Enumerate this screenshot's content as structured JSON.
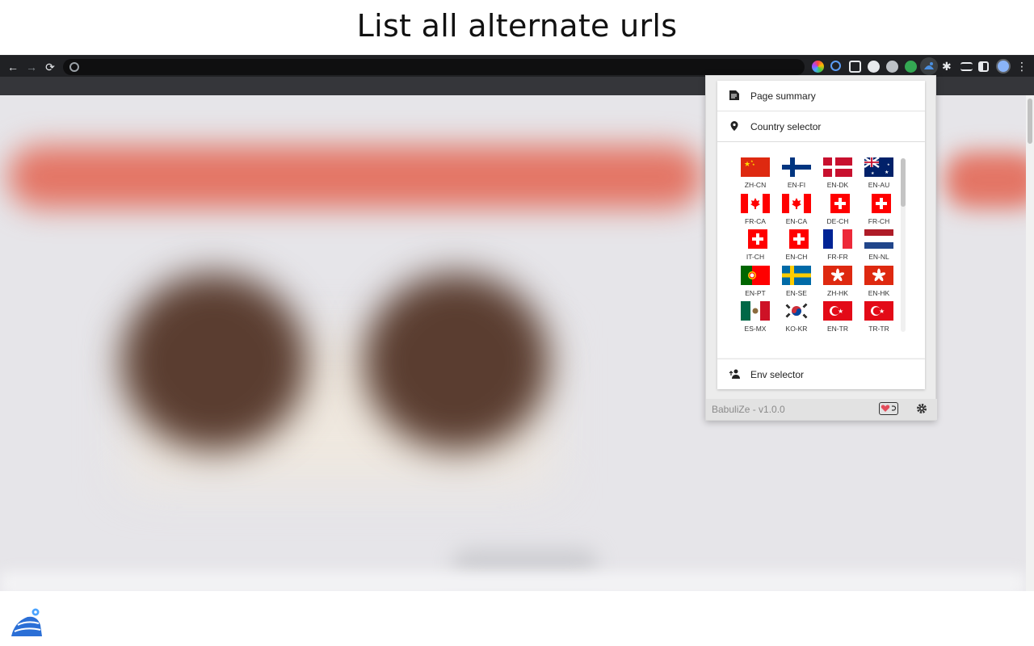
{
  "headline": "List all alternate urls",
  "browser": {
    "nav": {
      "back_icon": "←",
      "forward_icon": "→",
      "reload_icon": "⟳"
    }
  },
  "popup": {
    "menu": {
      "page_summary": "Page summary",
      "country_selector": "Country selector",
      "env_selector": "Env selector"
    },
    "countries": [
      {
        "code": "ZH-CN",
        "flag": "cn"
      },
      {
        "code": "EN-FI",
        "flag": "fi"
      },
      {
        "code": "EN-DK",
        "flag": "dk"
      },
      {
        "code": "EN-AU",
        "flag": "au"
      },
      {
        "code": "FR-CA",
        "flag": "ca"
      },
      {
        "code": "EN-CA",
        "flag": "ca"
      },
      {
        "code": "DE-CH",
        "flag": "ch"
      },
      {
        "code": "FR-CH",
        "flag": "ch"
      },
      {
        "code": "IT-CH",
        "flag": "ch"
      },
      {
        "code": "EN-CH",
        "flag": "ch"
      },
      {
        "code": "FR-FR",
        "flag": "fr"
      },
      {
        "code": "EN-NL",
        "flag": "nl"
      },
      {
        "code": "EN-PT",
        "flag": "pt"
      },
      {
        "code": "EN-SE",
        "flag": "se"
      },
      {
        "code": "ZH-HK",
        "flag": "hk"
      },
      {
        "code": "EN-HK",
        "flag": "hk"
      },
      {
        "code": "ES-MX",
        "flag": "mx"
      },
      {
        "code": "KO-KR",
        "flag": "kr"
      },
      {
        "code": "EN-TR",
        "flag": "tr"
      },
      {
        "code": "TR-TR",
        "flag": "tr"
      }
    ],
    "footer": {
      "version": "BabuliZe - v1.0.0"
    }
  },
  "colors": {
    "accent_red": "#e37565",
    "chrome_dark": "#202124",
    "popup_bg": "#ececec"
  }
}
